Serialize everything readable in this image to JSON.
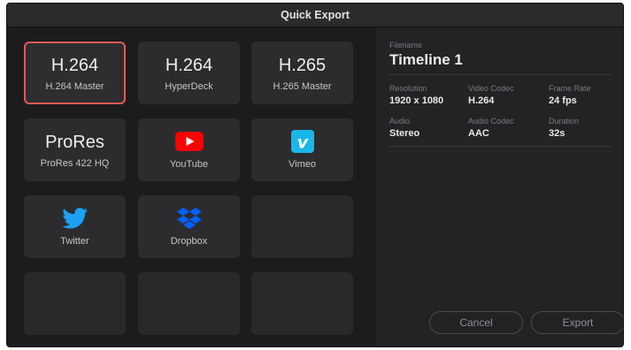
{
  "window": {
    "title": "Quick Export"
  },
  "presets": [
    {
      "big": "H.264",
      "label": "H.264 Master"
    },
    {
      "big": "H.264",
      "label": "HyperDeck"
    },
    {
      "big": "H.265",
      "label": "H.265 Master"
    },
    {
      "big": "ProRes",
      "label": "ProRes 422 HQ"
    },
    {
      "icon": "youtube-icon",
      "label": "YouTube"
    },
    {
      "icon": "vimeo-icon",
      "label": "Vimeo"
    },
    {
      "icon": "twitter-icon",
      "label": "Twitter"
    },
    {
      "icon": "dropbox-icon",
      "label": "Dropbox"
    }
  ],
  "details": {
    "filename_label": "Filename",
    "filename": "Timeline 1",
    "resolution_label": "Resolution",
    "resolution": "1920 x 1080",
    "video_codec_label": "Video Codec",
    "video_codec": "H.264",
    "frame_rate_label": "Frame Rate",
    "frame_rate": "24 fps",
    "audio_label": "Audio",
    "audio": "Stereo",
    "audio_codec_label": "Audio Codec",
    "audio_codec": "AAC",
    "duration_label": "Duration",
    "duration": "32s"
  },
  "buttons": {
    "cancel": "Cancel",
    "export": "Export"
  },
  "colors": {
    "selection": "#e35a58",
    "youtube": "#ff0000",
    "vimeo": "#1ab7ea",
    "twitter": "#1da1f2",
    "dropbox": "#0061ff"
  }
}
